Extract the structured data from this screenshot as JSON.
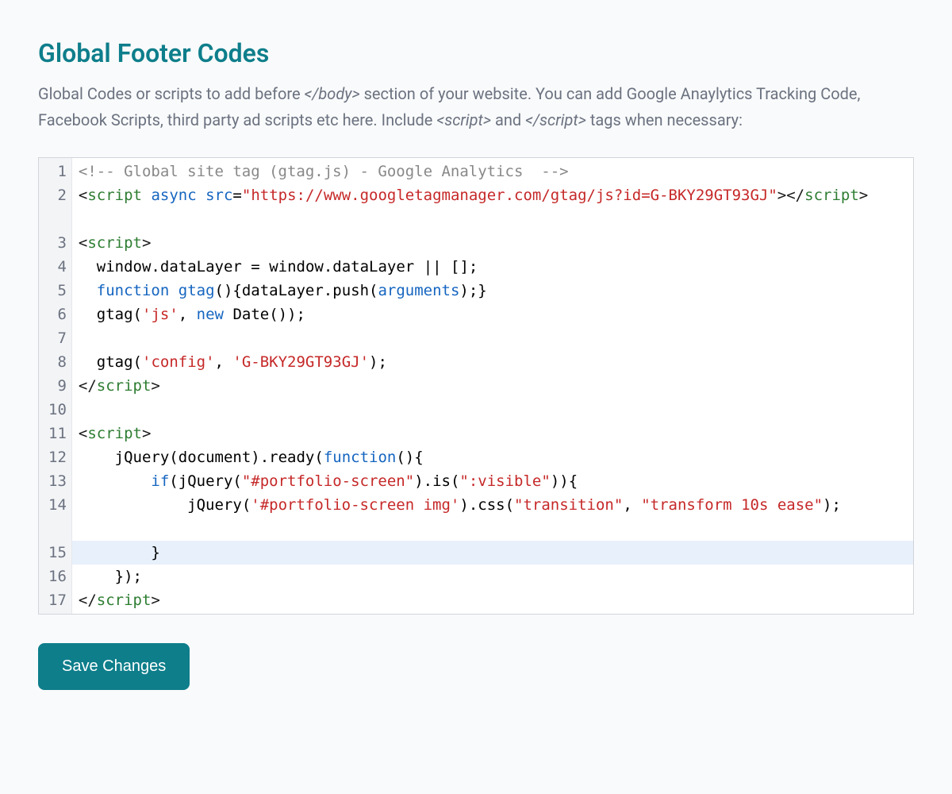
{
  "section": {
    "title": "Global Footer Codes",
    "description_parts": {
      "p1": "Global Codes or scripts to add before ",
      "body_tag": "</body>",
      "p2": " section of your website. You can add Google Anaylytics Tracking Code, Facebook Scripts, third party ad scripts etc here. Include ",
      "script_open": "<script>",
      "p3": " and ",
      "script_close": "</script>",
      "p4": " tags when necessary:"
    }
  },
  "editor": {
    "gutter_numbers": [
      "1",
      "2",
      "3",
      "4",
      "5",
      "6",
      "7",
      "8",
      "9",
      "10",
      "11",
      "12",
      "13",
      "14",
      "15",
      "16",
      "17"
    ],
    "highlighted_line": 15,
    "code_lines_plain": [
      "<!-- Global site tag (gtag.js) - Google Analytics  -->",
      "<script async src=\"https://www.googletagmanager.com/gtag/js?id=G-BKY29GT93GJ\"></script>",
      "<script>",
      "  window.dataLayer = window.dataLayer || [];",
      "  function gtag(){dataLayer.push(arguments);}",
      "  gtag('js', new Date());",
      "",
      "  gtag('config', 'G-BKY29GT93GJ');",
      "</script>",
      "",
      "<script>",
      "    jQuery(document).ready(function(){",
      "        if(jQuery(\"#portfolio-screen\").is(\":visible\")){",
      "            jQuery('#portfolio-screen img').css(\"transition\", \"transform 10s ease\");",
      "        }",
      "    });",
      "</script>"
    ]
  },
  "actions": {
    "save_label": "Save Changes"
  }
}
